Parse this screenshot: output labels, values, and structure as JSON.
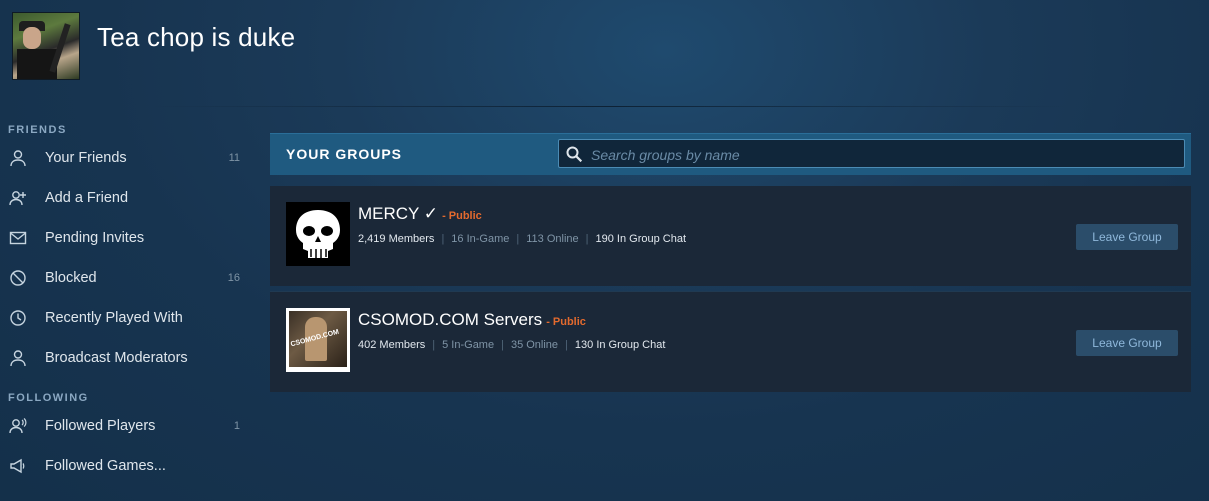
{
  "profile": {
    "username": "Tea chop is duke"
  },
  "sidebar": {
    "friends_title": "FRIENDS",
    "friends": [
      {
        "label": "Your Friends",
        "count": "11",
        "icon": "person-icon"
      },
      {
        "label": "Add a Friend",
        "count": "",
        "icon": "add-person-icon"
      },
      {
        "label": "Pending Invites",
        "count": "",
        "icon": "envelope-icon"
      },
      {
        "label": "Blocked",
        "count": "16",
        "icon": "block-icon"
      },
      {
        "label": "Recently Played With",
        "count": "",
        "icon": "clock-icon"
      },
      {
        "label": "Broadcast Moderators",
        "count": "",
        "icon": "person-icon"
      }
    ],
    "following_title": "FOLLOWING",
    "following": [
      {
        "label": "Followed Players",
        "count": "1",
        "icon": "followed-players-icon"
      },
      {
        "label": "Followed Games...",
        "count": "",
        "icon": "megaphone-icon"
      }
    ]
  },
  "groups": {
    "title": "YOUR GROUPS",
    "search_placeholder": "Search groups by name",
    "list": [
      {
        "name": "MERCY ✓",
        "visibility": "- Public",
        "members": "2,419 Members",
        "in_game": "16 In-Game",
        "online": "113 Online",
        "in_chat": "190 In Group Chat",
        "leave_label": "Leave Group"
      },
      {
        "name": "CSOMOD.COM Servers",
        "visibility": "- Public",
        "members": "402 Members",
        "in_game": "5 In-Game",
        "online": "35 Online",
        "in_chat": "130 In Group Chat",
        "leave_label": "Leave Group",
        "avatar_text": "CSOMOD.COM"
      }
    ]
  },
  "colors": {
    "public": "#e36a2e",
    "header_bar": "#1f5a80",
    "card_bg": "#1b2838"
  }
}
